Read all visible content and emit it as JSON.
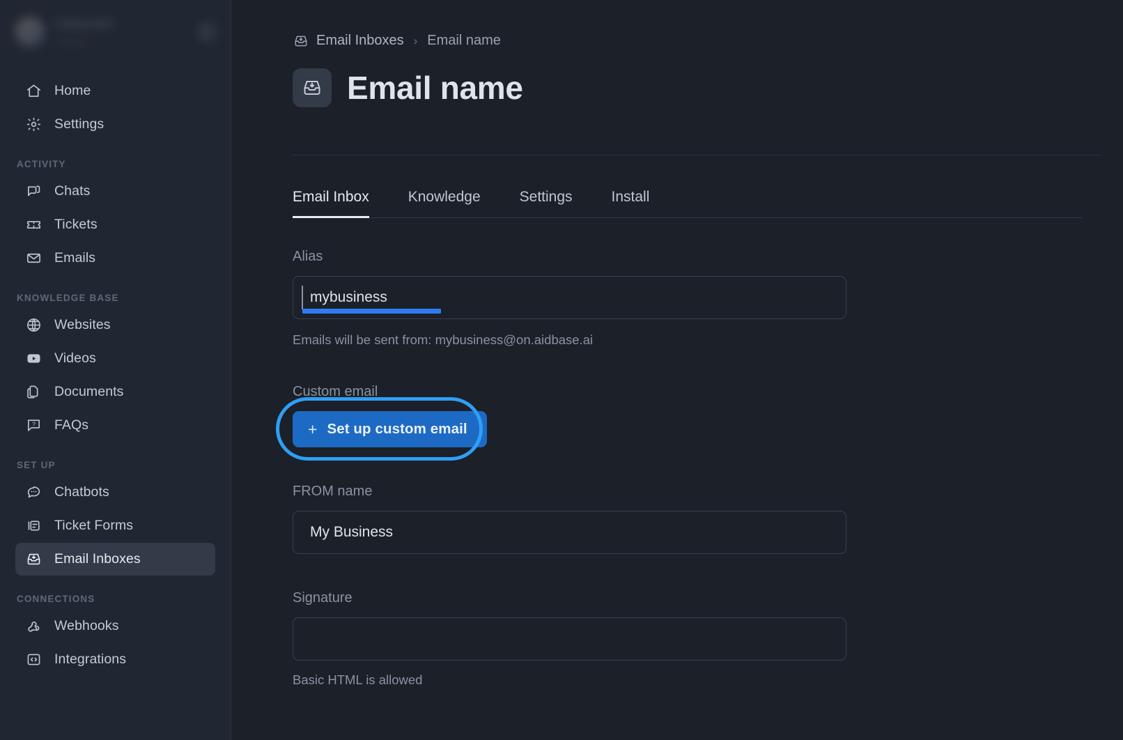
{
  "sidebar": {
    "user": {
      "name": "redacted",
      "subtitle": "redacted",
      "action_icon": "user-menu-icon"
    },
    "groups": [
      {
        "title": "",
        "items": [
          {
            "label": "Home",
            "icon": "home-icon",
            "active": false
          },
          {
            "label": "Settings",
            "icon": "gear-icon",
            "active": false
          }
        ]
      },
      {
        "title": "ACTIVITY",
        "items": [
          {
            "label": "Chats",
            "icon": "chat-bubble-icon",
            "active": false
          },
          {
            "label": "Tickets",
            "icon": "ticket-icon",
            "active": false
          },
          {
            "label": "Emails",
            "icon": "envelope-icon",
            "active": false
          }
        ]
      },
      {
        "title": "KNOWLEDGE BASE",
        "items": [
          {
            "label": "Websites",
            "icon": "globe-icon",
            "active": false
          },
          {
            "label": "Videos",
            "icon": "video-play-icon",
            "active": false
          },
          {
            "label": "Documents",
            "icon": "documents-icon",
            "active": false
          },
          {
            "label": "FAQs",
            "icon": "faq-question-icon",
            "active": false
          }
        ]
      },
      {
        "title": "SET UP",
        "items": [
          {
            "label": "Chatbots",
            "icon": "chatbot-bubble-icon",
            "active": false
          },
          {
            "label": "Ticket Forms",
            "icon": "ticket-form-icon",
            "active": false
          },
          {
            "label": "Email Inboxes",
            "icon": "inbox-icon",
            "active": true
          }
        ]
      },
      {
        "title": "CONNECTIONS",
        "items": [
          {
            "label": "Webhooks",
            "icon": "webhook-icon",
            "active": false
          },
          {
            "label": "Integrations",
            "icon": "code-brackets-icon",
            "active": false
          }
        ]
      }
    ]
  },
  "breadcrumb": {
    "icon": "inbox-icon",
    "parent": "Email Inboxes",
    "separator": "›",
    "current": "Email name"
  },
  "header": {
    "icon": "inbox-icon",
    "title": "Email name"
  },
  "tabs": [
    {
      "label": "Email Inbox",
      "active": true
    },
    {
      "label": "Knowledge",
      "active": false
    },
    {
      "label": "Settings",
      "active": false
    },
    {
      "label": "Install",
      "active": false
    }
  ],
  "form": {
    "alias": {
      "label": "Alias",
      "value": "mybusiness",
      "placeholder": "",
      "help": "Emails will be sent from: mybusiness@on.aidbase.ai"
    },
    "custom_email": {
      "label": "Custom email",
      "button_label": "Set up custom email",
      "button_plus": "+"
    },
    "from_name": {
      "label": "FROM name",
      "value": "My Business",
      "placeholder": ""
    },
    "signature": {
      "label": "Signature",
      "value": "",
      "placeholder": "",
      "help": "Basic HTML is allowed"
    }
  },
  "colors": {
    "accent_blue": "#1d6ac4",
    "highlight_ring": "#2f9ff5",
    "selection_bar": "#2f7df0",
    "sidebar_bg": "#212732",
    "main_bg": "#1b2029"
  }
}
